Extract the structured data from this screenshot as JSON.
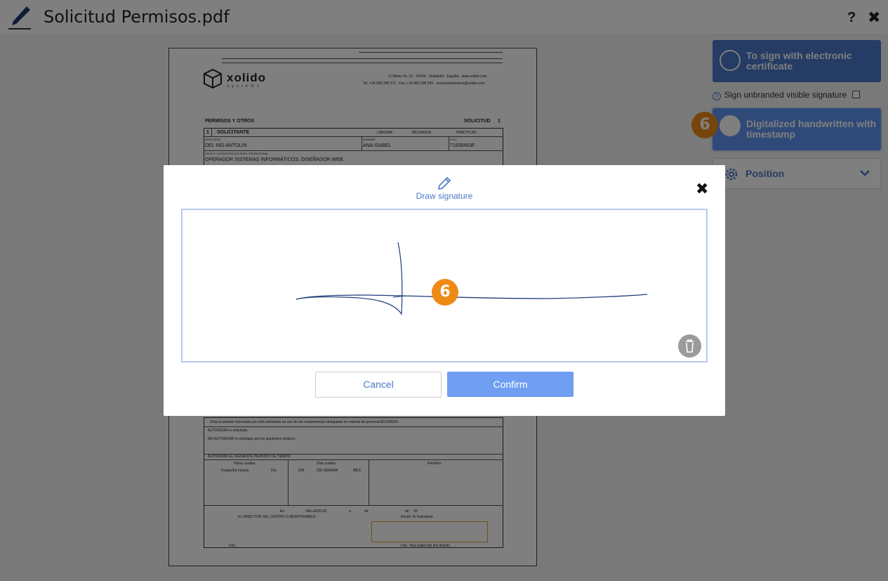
{
  "header": {
    "title": "Solicitud Permisos.pdf",
    "help_label": "?",
    "close_label": "✖"
  },
  "pdf": {
    "company": "xolido",
    "company_sub": "systems",
    "address_line1": "C/ Marte-Ya, 16 · 47004 · Valladolid · España · www.xolido.com",
    "address_line2": "Tel: +34 983 298 272 · Fax: +34 983 298 209 · recursoshumanos@xolido.com",
    "section_title": "PERMISOS Y OTROS",
    "request_label": "SOLICITUD",
    "request_number": "1",
    "applicant_num": "1",
    "applicant_label": "SOLICITANTE",
    "cb_laboral": "LABORAL",
    "cb_becario": "BECARIO/A",
    "cb_practicas": "PRÁCTICAS",
    "label_apellidos": "APELLIDOS",
    "label_nombre": "NOMBRE",
    "label_dni": "D.N.I.",
    "apellidos": "DEL RÍO ANTOLÍN",
    "nombre": "ANA ISABEL",
    "dni": "71939453F",
    "label_grupo": "GRUPO, CATEGORÍA O/O NIVEL PROFESIONAL",
    "grupo": "OPERADOR SISTEMAS INFORMÁTICOS. DISEÑADOR WEB.",
    "vista": "Vista la petición formulada por el/la solicitante en uso de las competencias delegadas en materia de personal ACUERDA:",
    "autorizar": "AUTORIZAR lo solicitado.",
    "no_autorizar": "NO AUTORIZAR lo solicitado por los siguientes motivos:",
    "autorizar_periodo": "AUTORIZAR EL SIGUIENTE PERIODO DE TIEMPO",
    "horas_sueltas": "Horas sueltas",
    "franja_horaria": "Franja/día horaria",
    "dia": "Día",
    "dias_sueltos": "Días sueltos",
    "col_dia": "DÍA",
    "col_dia_semana": "DÍA SEMANA",
    "col_mes": "MES",
    "periodos": "Periodos",
    "en": "En",
    "ciudad": "VALLADOLID",
    "a": "a",
    "de1": "de",
    "de2": "de",
    "year": "20",
    "director": "EL DIRECTOR DEL CENTRO O RESPONSABLE",
    "recibi": "Recibí: El Solicitante",
    "fdo1": "Fdo.:",
    "fdo2": "Fdo.: Ana Isabel del Río Antolín"
  },
  "panel": {
    "cert_label": "To sign with electronic certificate",
    "unbranded_label": "Sign unbranded visible signature",
    "handwritten_label": "Digitalized handwritten with timestamp",
    "position_label": "Position",
    "step_badge": "6"
  },
  "modal": {
    "title": "Draw signature",
    "close_label": "✖",
    "step_badge": "6",
    "cancel_label": "Cancel",
    "confirm_label": "Confirm"
  },
  "colors": {
    "primary_blue": "#4a78c9",
    "button_blue": "#5e95f0",
    "confirm_blue": "#6f9ef2",
    "badge_orange": "#ef8a17",
    "signature_ink": "#1f3d7a"
  }
}
